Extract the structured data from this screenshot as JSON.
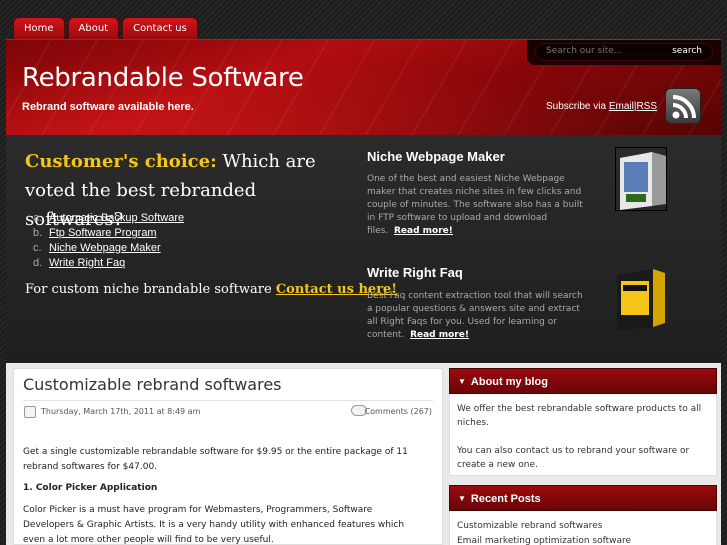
{
  "nav": [
    "Home",
    "About",
    "Contact us"
  ],
  "header": {
    "title": "Rebrandable Software",
    "tagline": "Rebrand software available here.",
    "search_placeholder": "Search our site...",
    "search_button": "search",
    "subscribe_prefix": "Subscribe via",
    "subscribe_email": "Email",
    "subscribe_sep": "|",
    "subscribe_rss": "RSS"
  },
  "feature": {
    "choice_gold": "Customer's choice:",
    "choice_rest": " Which are voted the best rebranded softwares?",
    "list": [
      {
        "marker": "a.",
        "label": "Automatic Backup Software"
      },
      {
        "marker": "b.",
        "label": "Ftp Software Program"
      },
      {
        "marker": "c.",
        "label": "Niche Webpage Maker"
      },
      {
        "marker": "d.",
        "label": "Write Right Faq"
      }
    ],
    "custom_text": "For custom niche brandable software ",
    "custom_link": "Contact us here!",
    "products": [
      {
        "title": "Niche Webpage Maker",
        "desc": "One of the best and easiest Niche Webpage maker that creates niche sites in few clicks and couple of minutes. The software also has a built in FTP software to upload and download files.",
        "more": "Read more!"
      },
      {
        "title": "Write Right Faq",
        "desc": "Best Faq content extraction tool that will search a popular questions & answers site and extract all Right Faqs for you. Used for learning or content.",
        "more": "Read more!"
      }
    ]
  },
  "post": {
    "title": "Customizable rebrand softwares",
    "date": "Thursday, March 17th, 2011 at 8:49 am",
    "comments": "Comments (267)",
    "p1": "Get a single customizable rebrandable software for $9.95 or the entire package of 11 rebrand softwares for $47.00.",
    "h1": "1. Color Picker Application",
    "p2": "Color Picker is a must have program for Webmasters, Programmers, Software Developers & Graphic Artists. It is a very handy utility with enhanced features which even a lot more other people will find to be very useful."
  },
  "sidebar": {
    "about_title": "About my blog",
    "about_p1": "We offer the best rebrandable software products to all niches.",
    "about_p2": "You can also contact us to rebrand your software or create a new one.",
    "recent_title": "Recent Posts",
    "recent": [
      "Customizable rebrand softwares",
      "Email marketing optimization software"
    ]
  }
}
